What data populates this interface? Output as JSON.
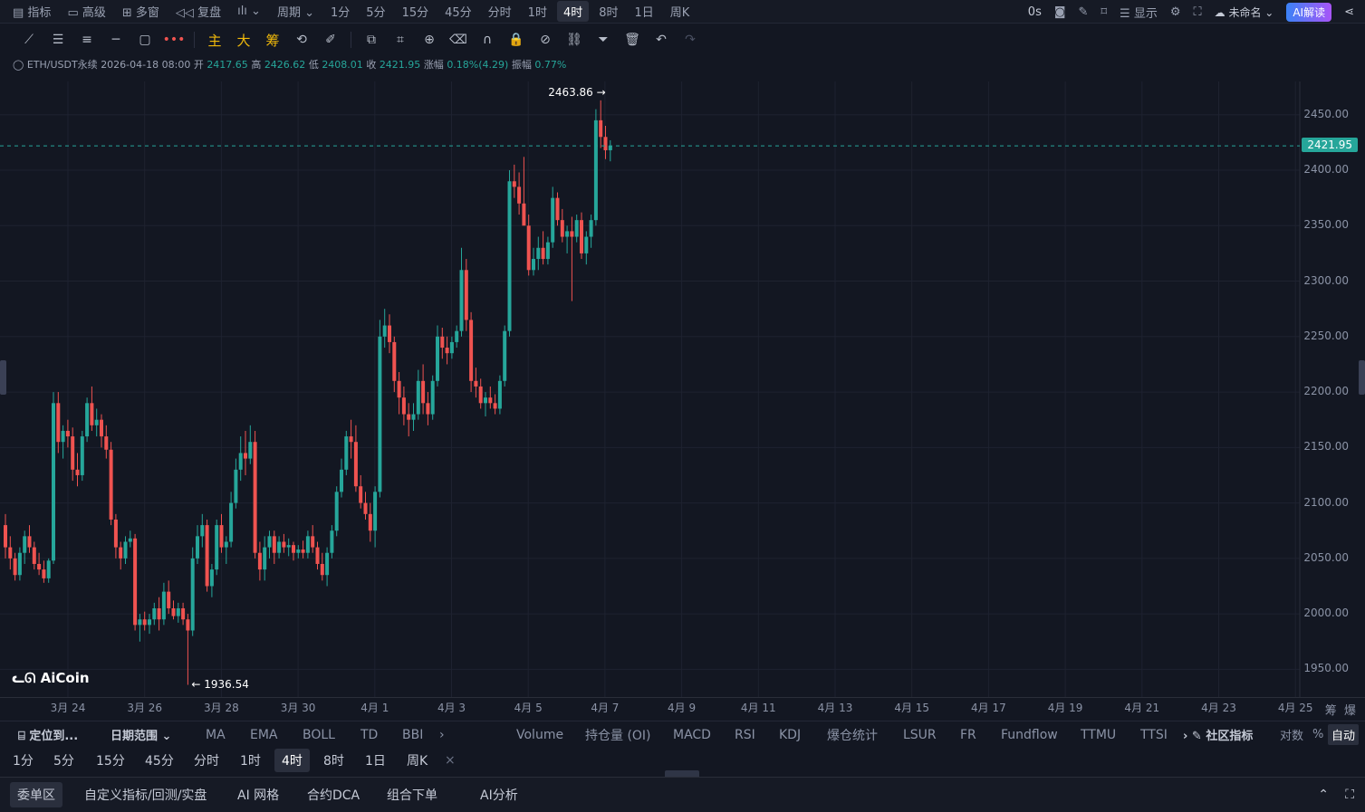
{
  "topbar": {
    "items": [
      "指标",
      "高级",
      "多窗",
      "复盘",
      "周期",
      "1分",
      "5分",
      "15分",
      "45分",
      "分时",
      "1时",
      "4时",
      "8时",
      "1日",
      "周K"
    ],
    "active": "4时",
    "countdown": "0s",
    "display": "显示",
    "layout_name": "未命名",
    "ai_button": "AI解读"
  },
  "drawbar": {
    "labels": [
      "主",
      "大",
      "筹"
    ]
  },
  "info": {
    "symbol": "ETH/USDT永续",
    "datetime": "2026-04-18 08:00",
    "open_label": "开",
    "open": "2417.65",
    "high_label": "高",
    "high": "2426.62",
    "low_label": "低",
    "low": "2408.01",
    "close_label": "收",
    "close": "2421.95",
    "change_label": "涨幅",
    "change": "0.18%(4.29)",
    "amp_label": "振幅",
    "amp": "0.77%"
  },
  "chart": {
    "current_price": "2421.95",
    "max_label": "2463.86",
    "min_label": "1936.54",
    "logo": "AiCoin",
    "price_ticks": [
      "2450.00",
      "2400.00",
      "2350.00",
      "2300.00",
      "2250.00",
      "2200.00",
      "2150.00",
      "2100.00",
      "2050.00",
      "2000.00",
      "1950.00"
    ],
    "date_ticks": [
      "3月 24",
      "3月 26",
      "3月 28",
      "3月 30",
      "4月 1",
      "4月 3",
      "4月 5",
      "4月 7",
      "4月 9",
      "4月 11",
      "4月 13",
      "4月 15",
      "4月 17",
      "4月 19",
      "4月 21",
      "4月 23",
      "4月 25"
    ],
    "corner_labels": [
      "筹",
      "爆"
    ]
  },
  "chart_data": {
    "type": "candlestick",
    "interval": "4h",
    "y_range": [
      1925,
      2480
    ],
    "up_color": "#26a69a",
    "down_color": "#ef5350",
    "ohlc": [
      [
        2080,
        2090,
        2050,
        2060
      ],
      [
        2060,
        2070,
        2040,
        2050
      ],
      [
        2050,
        2055,
        2030,
        2035
      ],
      [
        2035,
        2060,
        2030,
        2055
      ],
      [
        2055,
        2075,
        2045,
        2070
      ],
      [
        2070,
        2080,
        2055,
        2060
      ],
      [
        2060,
        2065,
        2040,
        2045
      ],
      [
        2045,
        2055,
        2035,
        2040
      ],
      [
        2040,
        2048,
        2028,
        2032
      ],
      [
        2032,
        2050,
        2028,
        2048
      ],
      [
        2048,
        2200,
        2045,
        2190
      ],
      [
        2190,
        2200,
        2145,
        2155
      ],
      [
        2155,
        2170,
        2140,
        2165
      ],
      [
        2165,
        2175,
        2150,
        2160
      ],
      [
        2160,
        2168,
        2120,
        2130
      ],
      [
        2130,
        2145,
        2115,
        2125
      ],
      [
        2125,
        2165,
        2120,
        2160
      ],
      [
        2160,
        2195,
        2155,
        2190
      ],
      [
        2190,
        2205,
        2165,
        2170
      ],
      [
        2170,
        2185,
        2160,
        2175
      ],
      [
        2175,
        2180,
        2150,
        2160
      ],
      [
        2160,
        2170,
        2140,
        2148
      ],
      [
        2148,
        2155,
        2080,
        2085
      ],
      [
        2085,
        2090,
        2050,
        2060
      ],
      [
        2060,
        2065,
        2040,
        2050
      ],
      [
        2050,
        2070,
        2045,
        2065
      ],
      [
        2065,
        2075,
        2060,
        2068
      ],
      [
        2068,
        2072,
        1985,
        1990
      ],
      [
        1990,
        2000,
        1975,
        1995
      ],
      [
        1995,
        2002,
        1985,
        1990
      ],
      [
        1990,
        2000,
        1982,
        1995
      ],
      [
        1995,
        2010,
        1990,
        2005
      ],
      [
        2005,
        2015,
        1985,
        1995
      ],
      [
        1995,
        2028,
        1990,
        2020
      ],
      [
        2020,
        2030,
        2000,
        2005
      ],
      [
        2005,
        2012,
        1995,
        1998
      ],
      [
        1998,
        2010,
        1992,
        2005
      ],
      [
        2005,
        2010,
        1990,
        1995
      ],
      [
        1995,
        2000,
        1936,
        1985
      ],
      [
        1985,
        2060,
        1980,
        2050
      ],
      [
        2050,
        2080,
        2045,
        2070
      ],
      [
        2070,
        2090,
        2060,
        2080
      ],
      [
        2080,
        2085,
        2020,
        2025
      ],
      [
        2025,
        2045,
        2015,
        2040
      ],
      [
        2040,
        2085,
        2035,
        2080
      ],
      [
        2080,
        2090,
        2055,
        2060
      ],
      [
        2060,
        2070,
        2045,
        2065
      ],
      [
        2065,
        2110,
        2060,
        2100
      ],
      [
        2100,
        2140,
        2095,
        2130
      ],
      [
        2130,
        2160,
        2120,
        2145
      ],
      [
        2145,
        2165,
        2125,
        2140
      ],
      [
        2140,
        2170,
        2135,
        2155
      ],
      [
        2155,
        2165,
        2050,
        2055
      ],
      [
        2055,
        2065,
        2030,
        2040
      ],
      [
        2040,
        2070,
        2030,
        2060
      ],
      [
        2060,
        2075,
        2050,
        2070
      ],
      [
        2070,
        2075,
        2045,
        2055
      ],
      [
        2055,
        2070,
        2050,
        2065
      ],
      [
        2065,
        2072,
        2055,
        2060
      ],
      [
        2060,
        2068,
        2052,
        2062
      ],
      [
        2062,
        2065,
        2048,
        2055
      ],
      [
        2055,
        2062,
        2050,
        2058
      ],
      [
        2058,
        2066,
        2050,
        2055
      ],
      [
        2055,
        2075,
        2050,
        2070
      ],
      [
        2070,
        2080,
        2055,
        2060
      ],
      [
        2060,
        2065,
        2040,
        2045
      ],
      [
        2045,
        2055,
        2030,
        2035
      ],
      [
        2035,
        2060,
        2025,
        2055
      ],
      [
        2055,
        2080,
        2050,
        2075
      ],
      [
        2075,
        2115,
        2070,
        2110
      ],
      [
        2110,
        2140,
        2105,
        2130
      ],
      [
        2130,
        2165,
        2125,
        2160
      ],
      [
        2160,
        2175,
        2140,
        2155
      ],
      [
        2155,
        2170,
        2110,
        2115
      ],
      [
        2115,
        2125,
        2095,
        2100
      ],
      [
        2100,
        2110,
        2085,
        2090
      ],
      [
        2090,
        2100,
        2065,
        2075
      ],
      [
        2075,
        2115,
        2060,
        2110
      ],
      [
        2110,
        2265,
        2105,
        2250
      ],
      [
        2250,
        2275,
        2240,
        2260
      ],
      [
        2260,
        2270,
        2235,
        2245
      ],
      [
        2245,
        2250,
        2200,
        2210
      ],
      [
        2210,
        2218,
        2180,
        2195
      ],
      [
        2195,
        2205,
        2170,
        2180
      ],
      [
        2180,
        2190,
        2160,
        2175
      ],
      [
        2175,
        2190,
        2165,
        2180
      ],
      [
        2180,
        2220,
        2175,
        2210
      ],
      [
        2210,
        2225,
        2180,
        2190
      ],
      [
        2190,
        2200,
        2170,
        2180
      ],
      [
        2180,
        2215,
        2175,
        2210
      ],
      [
        2210,
        2260,
        2205,
        2250
      ],
      [
        2250,
        2258,
        2230,
        2240
      ],
      [
        2240,
        2250,
        2225,
        2235
      ],
      [
        2235,
        2250,
        2230,
        2245
      ],
      [
        2245,
        2260,
        2240,
        2255
      ],
      [
        2255,
        2330,
        2250,
        2310
      ],
      [
        2310,
        2320,
        2255,
        2265
      ],
      [
        2265,
        2272,
        2200,
        2210
      ],
      [
        2210,
        2222,
        2195,
        2205
      ],
      [
        2205,
        2212,
        2185,
        2190
      ],
      [
        2190,
        2200,
        2178,
        2195
      ],
      [
        2195,
        2205,
        2185,
        2190
      ],
      [
        2190,
        2198,
        2180,
        2185
      ],
      [
        2185,
        2215,
        2180,
        2210
      ],
      [
        2210,
        2260,
        2205,
        2255
      ],
      [
        2255,
        2400,
        2250,
        2390
      ],
      [
        2390,
        2405,
        2375,
        2385
      ],
      [
        2385,
        2398,
        2360,
        2370
      ],
      [
        2370,
        2412,
        2355,
        2350
      ],
      [
        2350,
        2360,
        2305,
        2310
      ],
      [
        2310,
        2330,
        2305,
        2320
      ],
      [
        2320,
        2340,
        2310,
        2330
      ],
      [
        2330,
        2345,
        2315,
        2320
      ],
      [
        2320,
        2340,
        2315,
        2335
      ],
      [
        2335,
        2385,
        2330,
        2375
      ],
      [
        2375,
        2380,
        2350,
        2355
      ],
      [
        2355,
        2365,
        2335,
        2340
      ],
      [
        2340,
        2350,
        2325,
        2345
      ],
      [
        2345,
        2358,
        2282,
        2340
      ],
      [
        2340,
        2360,
        2335,
        2355
      ],
      [
        2355,
        2362,
        2320,
        2325
      ],
      [
        2325,
        2345,
        2315,
        2340
      ],
      [
        2340,
        2360,
        2330,
        2355
      ],
      [
        2355,
        2455,
        2350,
        2445
      ],
      [
        2445,
        2463,
        2420,
        2430
      ],
      [
        2430,
        2440,
        2410,
        2418
      ],
      [
        2418,
        2427,
        2408,
        2422
      ]
    ]
  },
  "indbar": {
    "left": [
      "定位到...",
      "日期范围"
    ],
    "main": [
      "MA",
      "EMA",
      "BOLL",
      "TD",
      "BBI"
    ],
    "sub": [
      "Volume",
      "持仓量 (OI)",
      "MACD",
      "RSI",
      "KDJ",
      "爆仓统计",
      "LSUR",
      "FR",
      "Fundflow",
      "TTMU",
      "TTSI"
    ],
    "community": "社区指标",
    "log": "对数",
    "percent": "%",
    "auto": "自动"
  },
  "periodbar": {
    "items": [
      "1分",
      "5分",
      "15分",
      "45分",
      "分时",
      "1时",
      "4时",
      "8时",
      "1日",
      "周K"
    ],
    "active": "4时"
  },
  "bottombar": {
    "tabs": [
      "委单区",
      "自定义指标/回测/实盘",
      "AI 网格",
      "合约DCA",
      "组合下单",
      "AI分析"
    ]
  }
}
